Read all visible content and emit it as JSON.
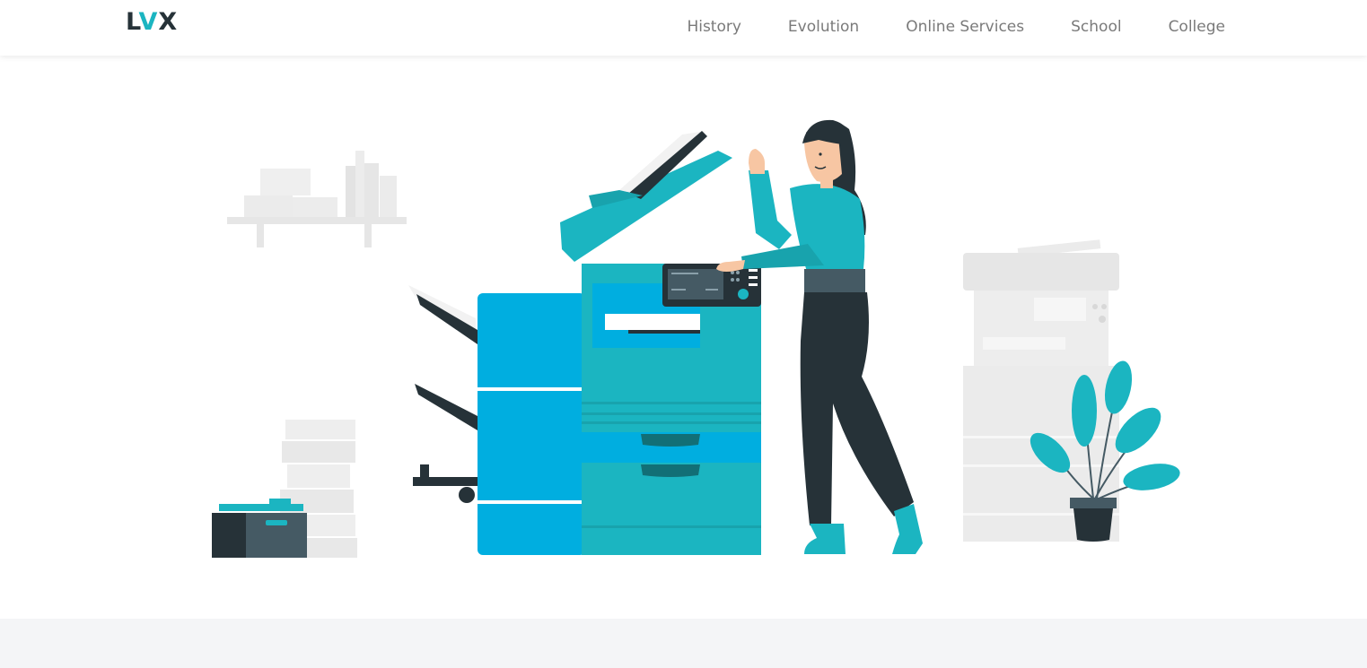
{
  "brand": {
    "logo_left": "L",
    "logo_accent": "V",
    "logo_right": "X"
  },
  "nav": {
    "items": [
      {
        "label": "History"
      },
      {
        "label": "Evolution"
      },
      {
        "label": "Online Services"
      },
      {
        "label": "School"
      },
      {
        "label": "College"
      }
    ]
  },
  "colors": {
    "accent": "#1bb5c1",
    "dark": "#263238",
    "nav_text": "#7a7a7a",
    "band": "#f4f5f7"
  },
  "hero": {
    "illustration": "woman-using-photocopier-illustration"
  }
}
